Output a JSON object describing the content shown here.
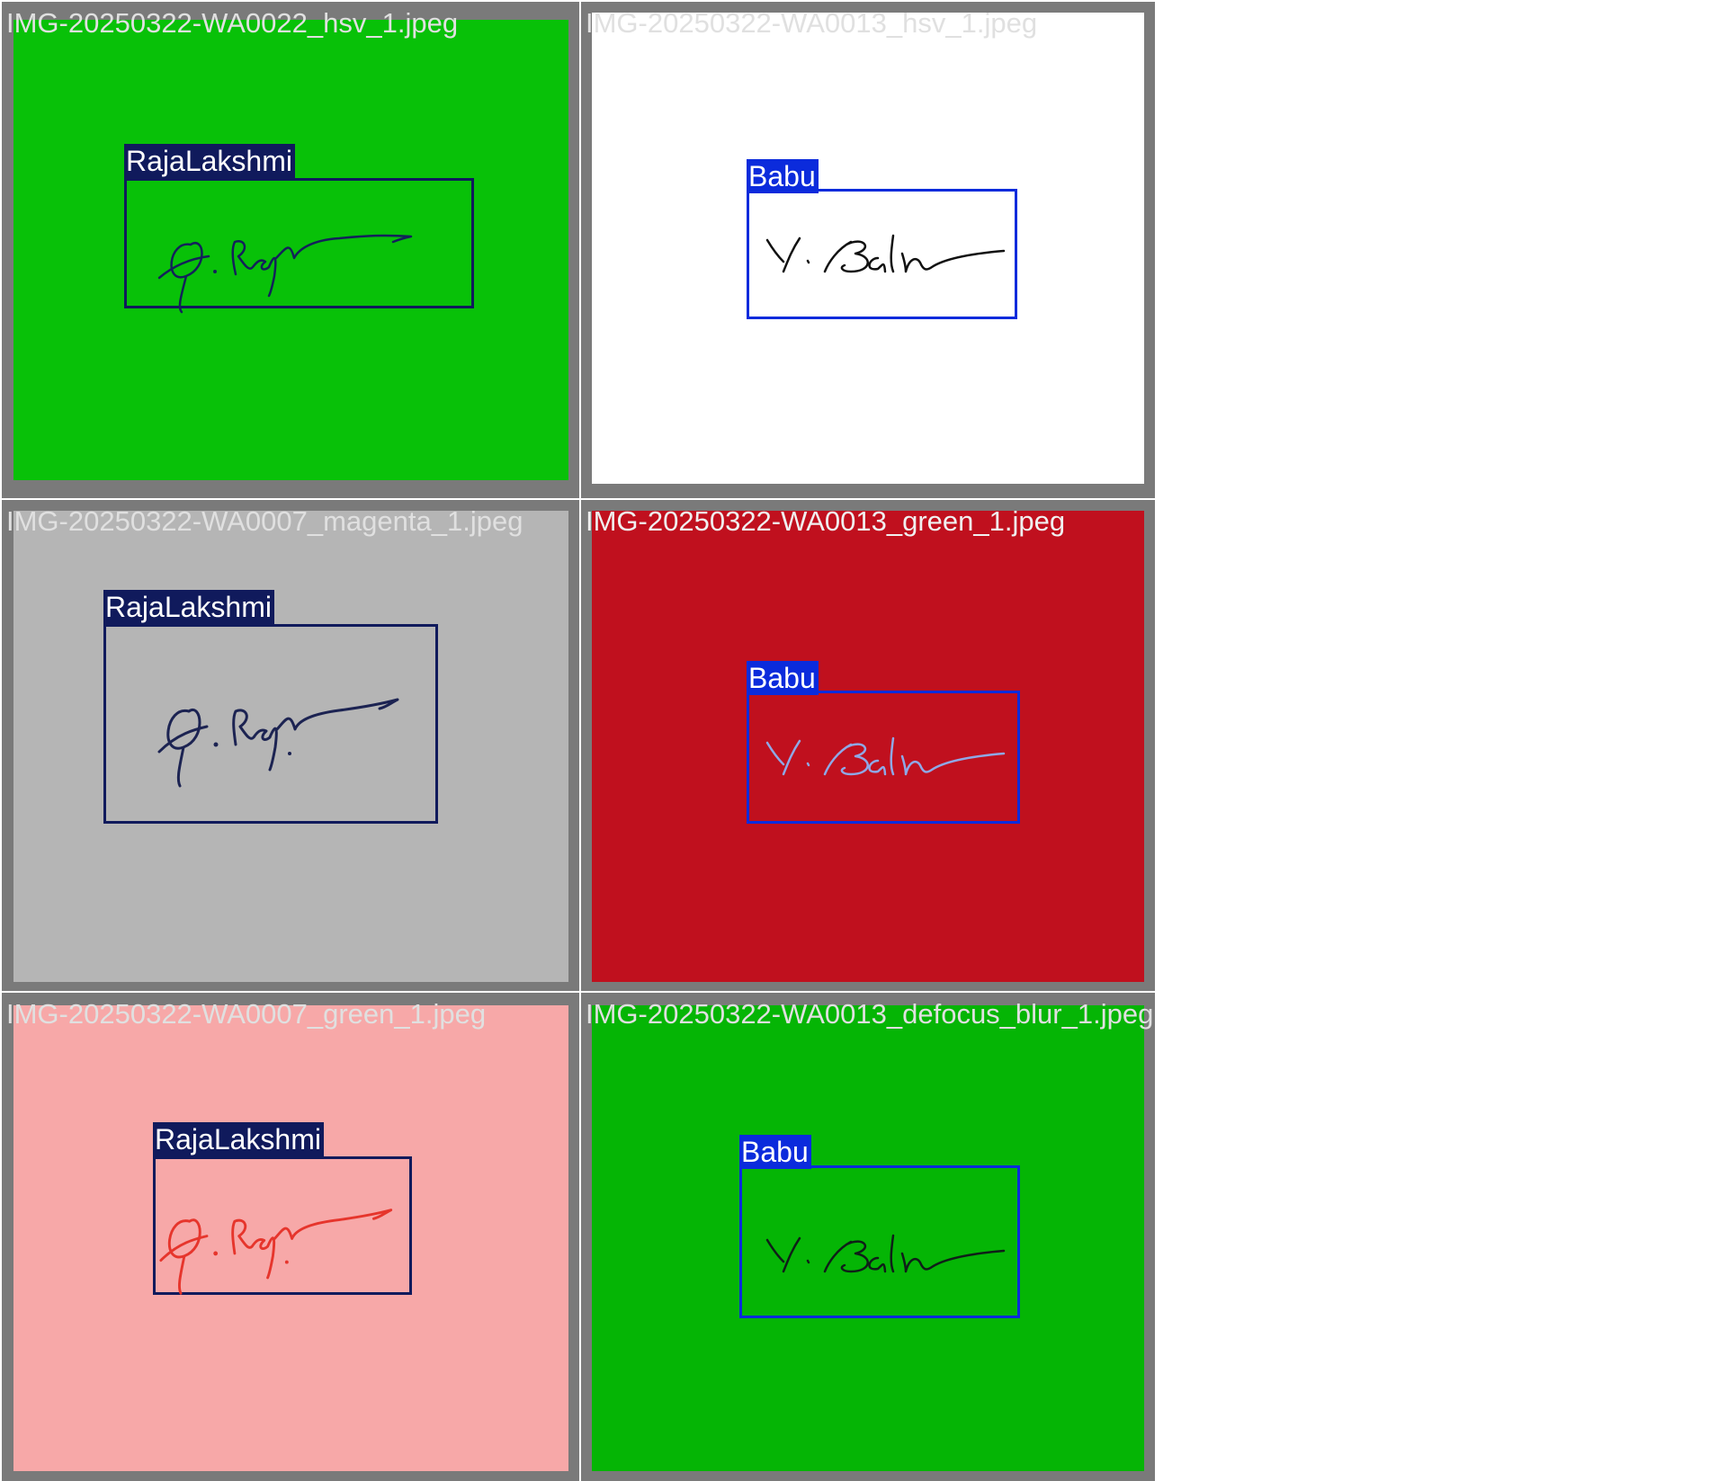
{
  "grid": {
    "tiles": [
      {
        "filename": "IMG-20250322-WA0022_hsv_1.jpeg",
        "label": "RajaLakshmi",
        "background": "#08c108",
        "label_color": "#101a5c",
        "ink": "#13215a"
      },
      {
        "filename": "IMG-20250322-WA0013_hsv_1.jpeg",
        "label": "Babu",
        "background": "#ffffff",
        "label_color": "#0b2bdc",
        "ink": "#111111"
      },
      {
        "filename": "IMG-20250322-WA0007_magenta_1.jpeg",
        "label": "RajaLakshmi",
        "background": "#b5b5b5",
        "label_color": "#101a5c",
        "ink": "#1c2352"
      },
      {
        "filename": "IMG-20250322-WA0013_green_1.jpeg",
        "label": "Babu",
        "background": "#c0101e",
        "label_color": "#0b2bdc",
        "ink": "#7f9fe0"
      },
      {
        "filename": "IMG-20250322-WA0007_green_1.jpeg",
        "label": "RajaLakshmi",
        "background": "#f7a8a8",
        "label_color": "#101a5c",
        "ink": "#e6352c"
      },
      {
        "filename": "IMG-20250322-WA0013_defocus_blur_1.jpeg",
        "label": "Babu",
        "background": "#05b505",
        "label_color": "#0b2bdc",
        "ink": "#0f1f18"
      }
    ]
  }
}
